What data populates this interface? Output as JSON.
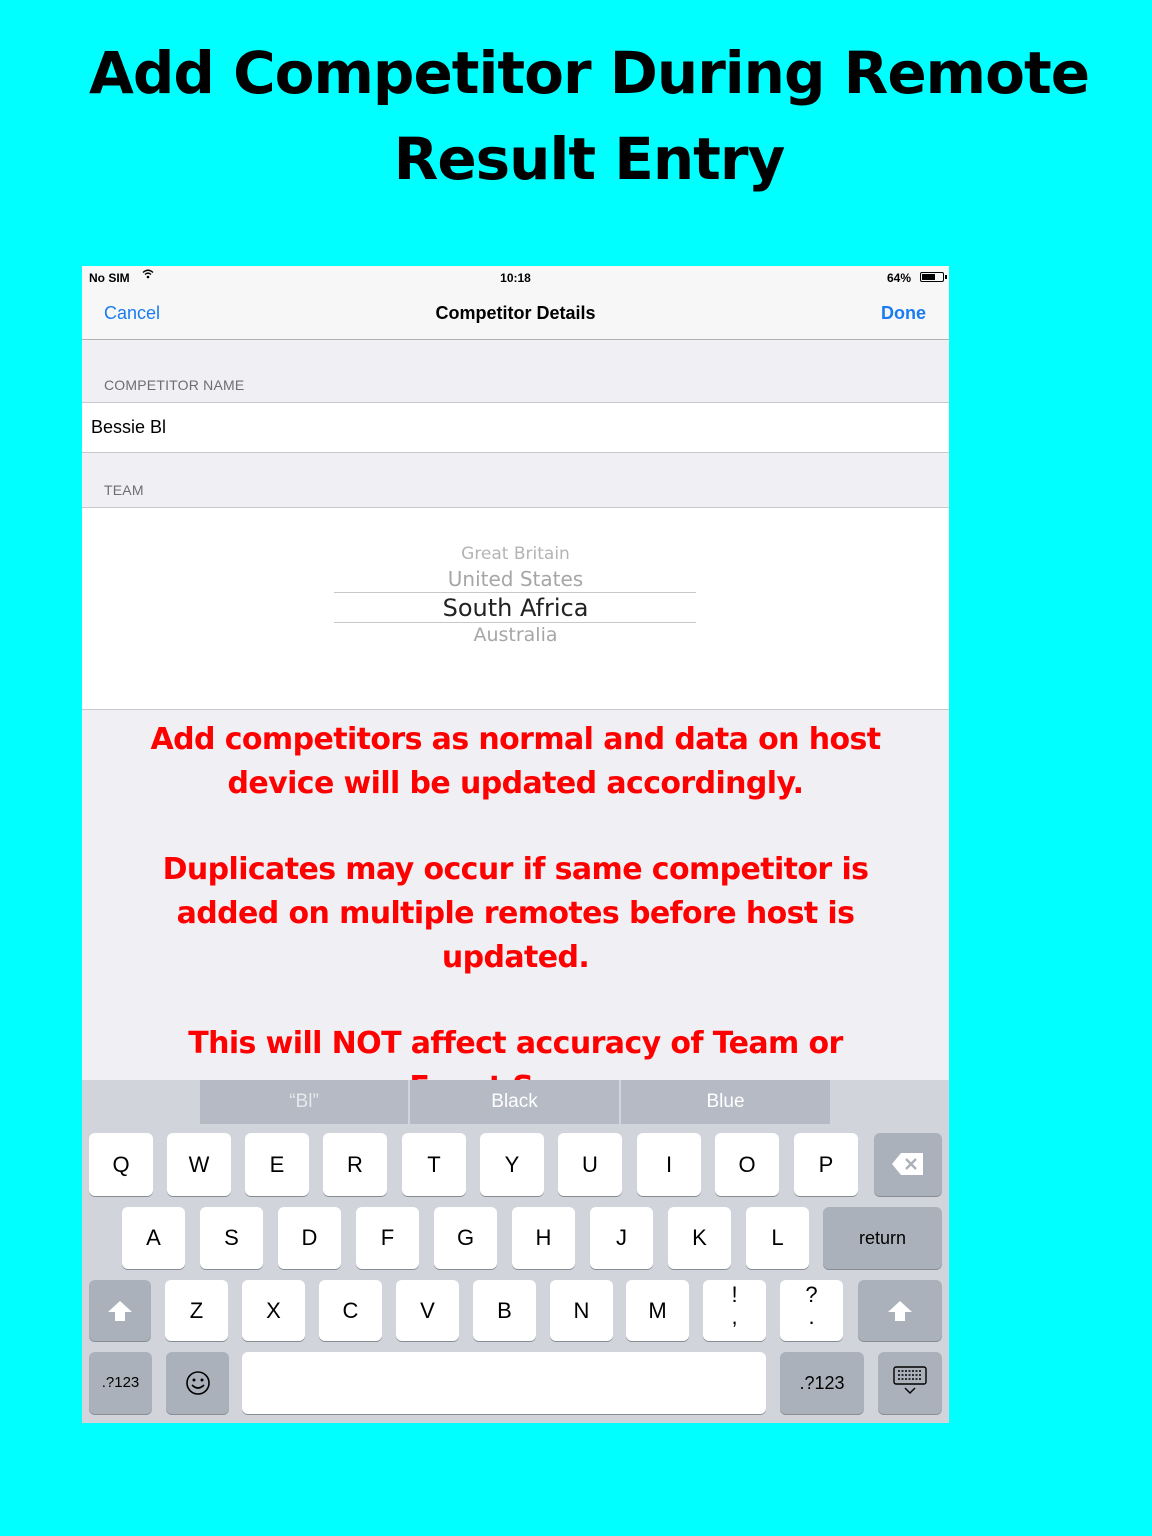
{
  "headline": {
    "line1": "Add Competitor During Remote",
    "line2": "Result Entry"
  },
  "status_bar": {
    "carrier": "No SIM",
    "wifi_icon": "wifi-icon",
    "time": "10:18",
    "battery": "64%"
  },
  "nav": {
    "cancel": "Cancel",
    "title": "Competitor Details",
    "done": "Done"
  },
  "form": {
    "name_label": "COMPETITOR NAME",
    "name_value": "Bessie Bl",
    "team_label": "TEAM",
    "team_options": [
      "Great Britain",
      "United States",
      "South Africa",
      "Australia"
    ],
    "team_selected": "South Africa"
  },
  "notes": [
    "Add competitors as normal and data on host device will be updated accordingly.",
    "Duplicates may occur if same competitor is added on multiple remotes before host is updated.",
    "This will NOT affect accuracy of Team or Event Scores"
  ],
  "keyboard": {
    "predictions": [
      "“Bl”",
      "Black",
      "Blue"
    ],
    "row1": [
      "Q",
      "W",
      "E",
      "R",
      "T",
      "Y",
      "U",
      "I",
      "O",
      "P"
    ],
    "row2": [
      "A",
      "S",
      "D",
      "F",
      "G",
      "H",
      "J",
      "K",
      "L"
    ],
    "return": "return",
    "row3": [
      "Z",
      "X",
      "C",
      "V",
      "B",
      "N",
      "M"
    ],
    "punct1": {
      "top": "!",
      "bottom": ","
    },
    "punct2": {
      "top": "?",
      "bottom": "."
    },
    "numbers_key": ".?123",
    "icons": {
      "delete": "delete-icon",
      "shift": "shift-icon",
      "emoji": "emoji-icon",
      "hide": "keyboard-hide-icon"
    }
  },
  "colors": {
    "background": "#00ffff",
    "note_text": "#ff0000",
    "ios_blue": "#1a7cf0"
  }
}
